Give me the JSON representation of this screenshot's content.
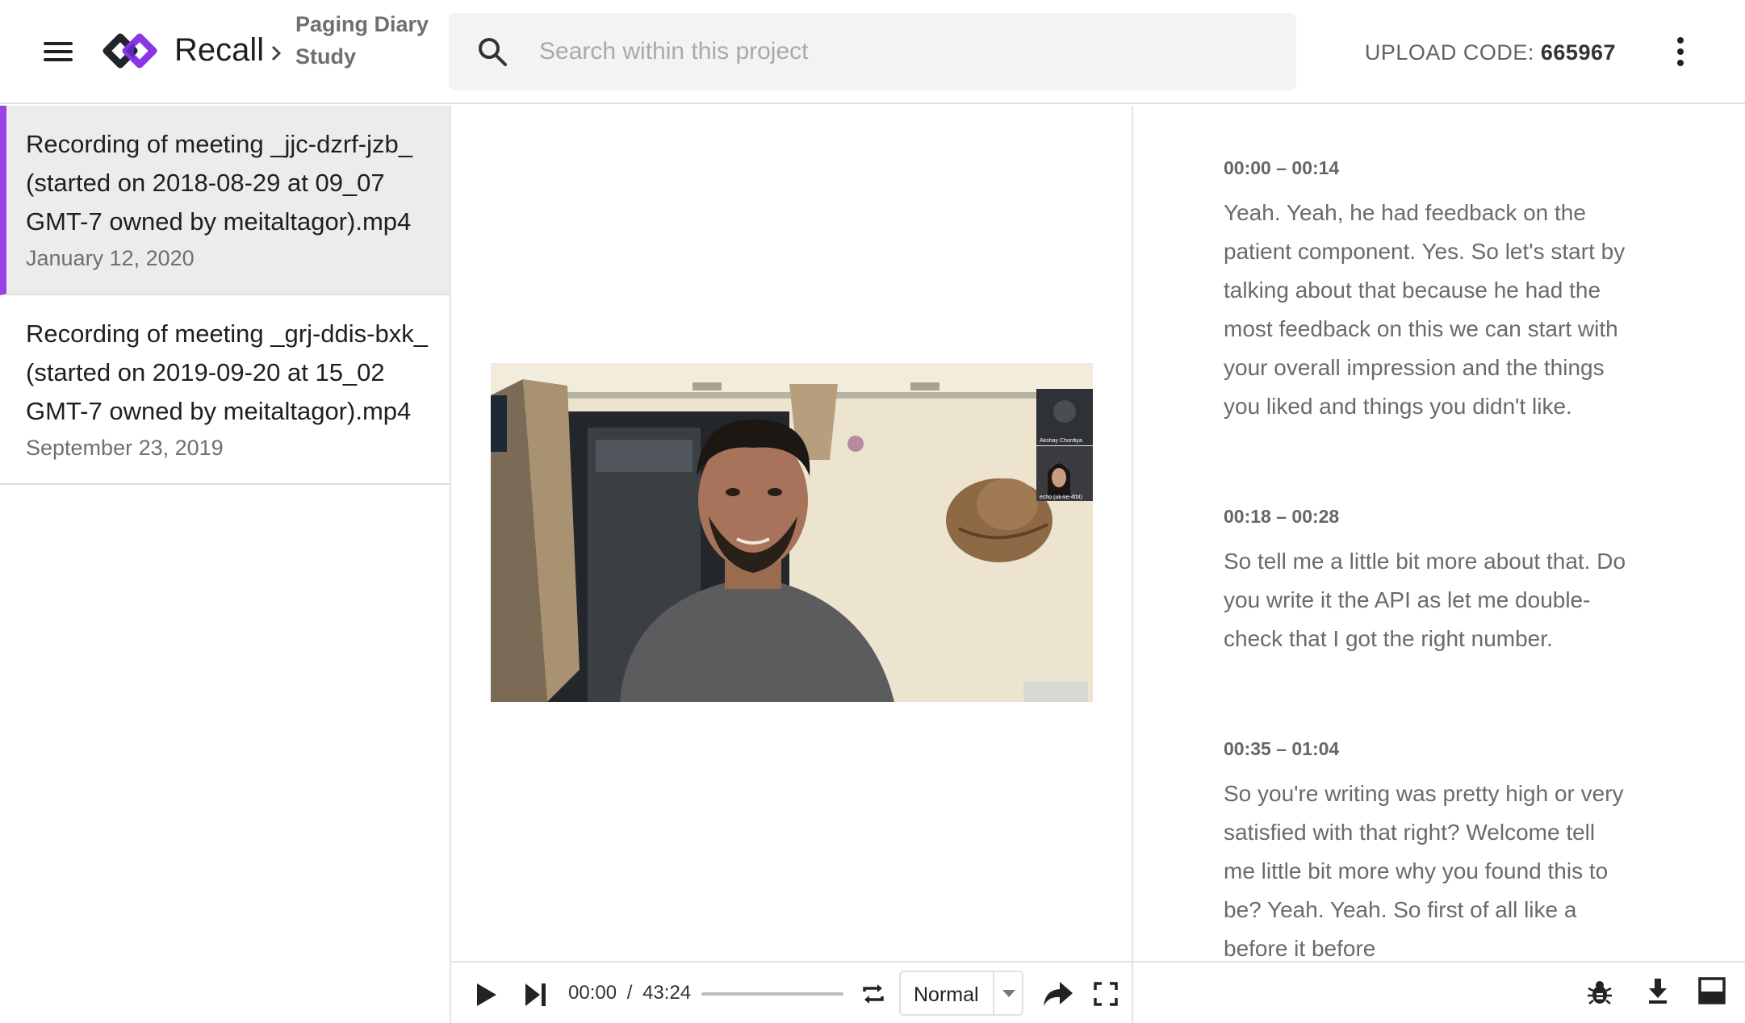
{
  "app": {
    "brand": "Recall",
    "project_name": "Paging Diary Study",
    "brand_color": "#7b3fe4"
  },
  "search": {
    "placeholder": "Search within this project",
    "value": ""
  },
  "upload": {
    "label": "UPLOAD CODE:",
    "code": "665967"
  },
  "recordings": [
    {
      "title": "Recording of meeting _jjc-dzrf-jzb_ (started on 2018-08-29 at 09_07 GMT-7 owned by meitaltagor).mp4",
      "date": "January 12, 2020",
      "selected": true
    },
    {
      "title": "Recording of meeting _grj-ddis-bxk_ (started on 2019-09-20 at 15_02 GMT-7 owned by meitaltagor).mp4",
      "date": "September 23, 2019",
      "selected": false
    }
  ],
  "player": {
    "current_time": "00:00",
    "separator": "/",
    "duration": "43:24",
    "progress": 0,
    "speed": "Normal",
    "participants": [
      "Akshay Chordiya",
      "echo (uk-ke-4fbt)"
    ]
  },
  "transcript": [
    {
      "time": "00:00 – 00:14",
      "text": "Yeah. Yeah, he had feedback on the patient component. Yes. So let's start by talking about that because he had the most feedback on this we can start with your overall impression and the things you liked and things you didn't like."
    },
    {
      "time": "00:18 – 00:28",
      "text": "So tell me a little bit more about that. Do you write it the API as let me double-check that I got the right number."
    },
    {
      "time": "00:35 – 01:04",
      "text": "So you're writing was pretty high or very satisfied with that right? Welcome tell me little bit more why you found this to be? Yeah. Yeah. So first of all like a before it before"
    }
  ]
}
